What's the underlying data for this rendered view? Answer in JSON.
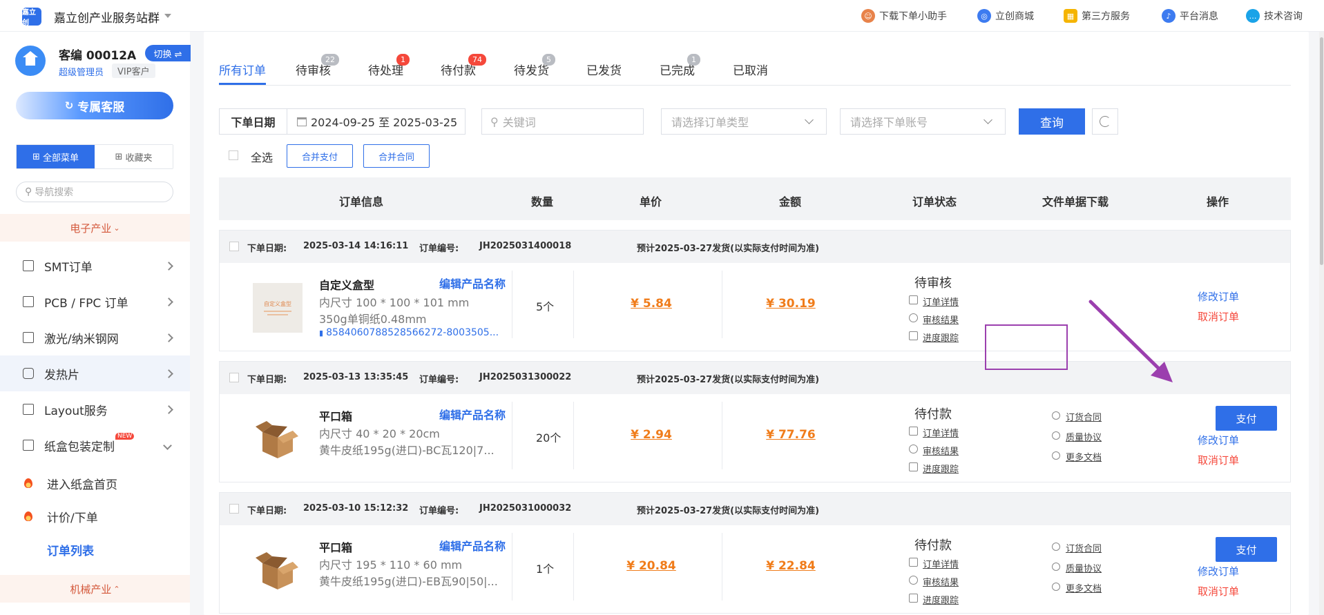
{
  "app": {
    "title": "嘉立创产业服务站群",
    "logo_text": "嘉立创"
  },
  "top_nav": [
    {
      "label": "下载下单小助手",
      "icon": "assistant-avatar-icon",
      "color": "#e8834a"
    },
    {
      "label": "立创商城",
      "icon": "mall-icon",
      "color": "#3d7bf0"
    },
    {
      "label": "第三方服务",
      "icon": "grid-apps-icon",
      "color": "#f5b400"
    },
    {
      "label": "平台消息",
      "icon": "bell-icon",
      "color": "#3d7bf0"
    },
    {
      "label": "技术咨询",
      "icon": "chat-icon",
      "color": "#1aa3e8"
    }
  ],
  "user": {
    "id": "客编 00012A",
    "switch_label": "切换 ⇌",
    "role": "超级管理员",
    "tag": "VIP客户"
  },
  "sidebar": {
    "service_button": "专属客服",
    "menu_tabs": [
      "全部菜单",
      "收藏夹"
    ],
    "search_placeholder": "导航搜索",
    "group_electronics": "电子产业",
    "items": [
      {
        "label": "SMT订单"
      },
      {
        "label": "PCB / FPC 订单"
      },
      {
        "label": "激光/纳米钢网"
      },
      {
        "label": "发热片"
      },
      {
        "label": "Layout服务"
      },
      {
        "label": "纸盒包装定制",
        "badge": "NEW"
      }
    ],
    "subitems": [
      {
        "label": "进入纸盒首页"
      },
      {
        "label": "计价/下单"
      },
      {
        "label": "订单列表"
      }
    ],
    "group_machinery": "机械产业"
  },
  "tabs": [
    {
      "label": "所有订单",
      "badge": ""
    },
    {
      "label": "待审核",
      "badge": "22"
    },
    {
      "label": "待处理",
      "badge": "1"
    },
    {
      "label": "待付款",
      "badge": "74"
    },
    {
      "label": "待发货",
      "badge": "5"
    },
    {
      "label": "已发货",
      "badge": ""
    },
    {
      "label": "已完成",
      "badge": "1"
    },
    {
      "label": "已取消",
      "badge": ""
    }
  ],
  "filters": {
    "date_label": "下单日期",
    "date_range": "2024-09-25 至 2025-03-25",
    "keyword_placeholder": "关键词",
    "order_type_placeholder": "请选择订单类型",
    "account_placeholder": "请选择下单账号",
    "query_label": "查询"
  },
  "bulk": {
    "select_all": "全选",
    "merge_pay": "合并支付",
    "merge_contract": "合并合同"
  },
  "table_headers": [
    "订单信息",
    "数量",
    "单价",
    "金额",
    "订单状态",
    "文件单据下载",
    "操作"
  ],
  "order_labels": {
    "date": "下单日期:",
    "number": "订单编号:",
    "edit_name": "编辑产品名称"
  },
  "orders": [
    {
      "date": "2025-03-14 14:16:11",
      "number": "JH2025031400018",
      "ship_note": "预计2025-03-27发货(以实际支付时间为准)",
      "product": "自定义盒型",
      "thumb_text": "自定义盒型",
      "spec1": "内尺寸 100 * 100 * 101 mm",
      "spec2": "350g单铜纸0.48mm",
      "file": "8584060788528566272-8003505...",
      "qty": "5个",
      "unit_price": "¥ 5.84",
      "amount": "¥ 30.19",
      "status": "待审核",
      "status_links": [
        "订单详情",
        "审核结果",
        "进度跟踪"
      ],
      "docs": [],
      "pay_label": "",
      "edit_label": "修改订单",
      "cancel_label": "取消订单"
    },
    {
      "date": "2025-03-13 13:35:45",
      "number": "JH2025031300022",
      "ship_note": "预计2025-03-27发货(以实际支付时间为准)",
      "product": "平口箱",
      "spec1": "内尺寸 40 * 20 * 20cm",
      "spec2": "黄牛皮纸195g(进口)-BC瓦120|7...",
      "file": "",
      "qty": "20个",
      "unit_price": "¥ 2.94",
      "amount": "¥ 77.76",
      "status": "待付款",
      "status_links": [
        "订单详情",
        "审核结果",
        "进度跟踪"
      ],
      "docs": [
        "订货合同",
        "质量协议",
        "更多文档"
      ],
      "pay_label": "支付",
      "edit_label": "修改订单",
      "cancel_label": "取消订单"
    },
    {
      "date": "2025-03-10 15:12:32",
      "number": "JH2025031000032",
      "ship_note": "预计2025-03-27发货(以实际支付时间为准)",
      "product": "平口箱",
      "spec1": "内尺寸 195 * 110 * 60 mm",
      "spec2": "黄牛皮纸195g(进口)-EB瓦90|50|...",
      "file": "",
      "qty": "1个",
      "unit_price": "¥ 20.84",
      "amount": "¥ 22.84",
      "status": "待付款",
      "status_links": [
        "订单详情",
        "审核结果",
        "进度跟踪"
      ],
      "docs": [
        "订货合同",
        "质量协议",
        "更多文档"
      ],
      "pay_label": "支付",
      "edit_label": "修改订单",
      "cancel_label": "取消订单"
    }
  ],
  "annotation_color": "#9b3fae"
}
